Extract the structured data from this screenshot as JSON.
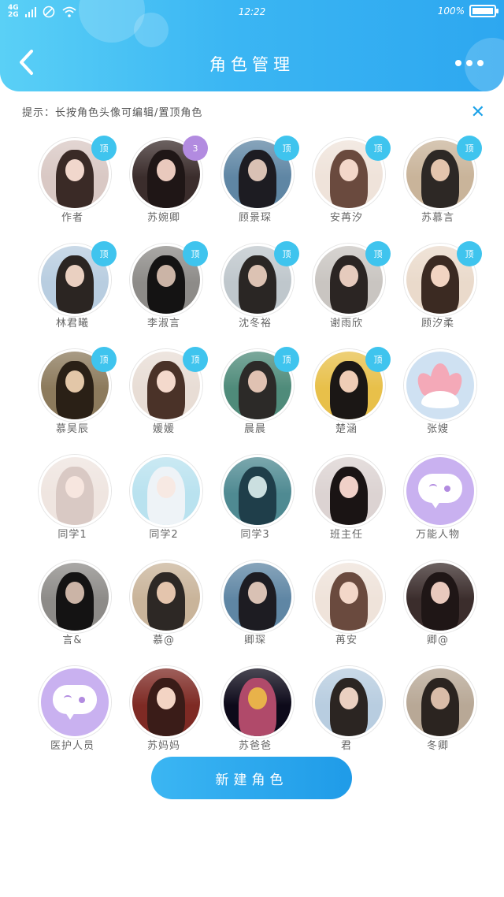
{
  "status": {
    "network_top": "4G",
    "network_bottom": "2G",
    "time": "12:22",
    "battery": "100%"
  },
  "header": {
    "title": "角色管理"
  },
  "hint": "提示：长按角色头像可编辑/置顶角色",
  "colors": {
    "accent": "#2da7f0",
    "badge_blue": "#3fc4ee",
    "badge_purple": "#b28be0"
  },
  "characters": [
    {
      "name": "作者",
      "badge": "顶",
      "badge_color": "blue",
      "img": "girl-flowers"
    },
    {
      "name": "苏婉卿",
      "badge": "3",
      "badge_color": "purple",
      "img": "girl-dark"
    },
    {
      "name": "顾景琛",
      "badge": "顶",
      "badge_color": "blue",
      "img": "boy-blue"
    },
    {
      "name": "安苒汐",
      "badge": "顶",
      "badge_color": "blue",
      "img": "girl-light"
    },
    {
      "name": "苏慕言",
      "badge": "顶",
      "badge_color": "blue",
      "img": "couple-paint"
    },
    {
      "name": "林君曦",
      "badge": "顶",
      "badge_color": "blue",
      "img": "girl-sea"
    },
    {
      "name": "李淑言",
      "badge": "顶",
      "badge_color": "blue",
      "img": "boy-dark"
    },
    {
      "name": "沈冬裕",
      "badge": "顶",
      "badge_color": "blue",
      "img": "boy-messy"
    },
    {
      "name": "谢雨欣",
      "badge": "顶",
      "badge_color": "blue",
      "img": "girl-curly"
    },
    {
      "name": "顾汐柔",
      "badge": "顶",
      "badge_color": "blue",
      "img": "girl-warm"
    },
    {
      "name": "慕昊辰",
      "badge": "顶",
      "badge_color": "blue",
      "img": "anime-boy"
    },
    {
      "name": "媛媛",
      "badge": "顶",
      "badge_color": "blue",
      "img": "girl-soft"
    },
    {
      "name": "晨晨",
      "badge": "顶",
      "badge_color": "blue",
      "img": "girl-map"
    },
    {
      "name": "楚涵",
      "badge": "顶",
      "badge_color": "blue",
      "img": "girl-yellow"
    },
    {
      "name": "张嫂",
      "badge": "",
      "badge_color": "",
      "img": "lotus"
    },
    {
      "name": "同学1",
      "badge": "",
      "badge_color": "",
      "img": "anime-girl-bear"
    },
    {
      "name": "同学2",
      "badge": "",
      "badge_color": "",
      "img": "anime-girl-white"
    },
    {
      "name": "同学3",
      "badge": "",
      "badge_color": "",
      "img": "anime-teal"
    },
    {
      "name": "班主任",
      "badge": "",
      "badge_color": "",
      "img": "girl-makeup"
    },
    {
      "name": "万能人物",
      "badge": "",
      "badge_color": "",
      "img": "chat"
    },
    {
      "name": "言&",
      "badge": "",
      "badge_color": "",
      "img": "boy-dark"
    },
    {
      "name": "慕@",
      "badge": "",
      "badge_color": "",
      "img": "couple-paint"
    },
    {
      "name": "卿琛",
      "badge": "",
      "badge_color": "",
      "img": "boy-blue"
    },
    {
      "name": "苒安",
      "badge": "",
      "badge_color": "",
      "img": "girl-light"
    },
    {
      "name": "卿@",
      "badge": "",
      "badge_color": "",
      "img": "girl-dark"
    },
    {
      "name": "医护人员",
      "badge": "",
      "badge_color": "",
      "img": "chat"
    },
    {
      "name": "苏妈妈",
      "badge": "",
      "badge_color": "",
      "img": "anime-queen"
    },
    {
      "name": "苏爸爸",
      "badge": "",
      "badge_color": "",
      "img": "night-lights"
    },
    {
      "name": "君",
      "badge": "",
      "badge_color": "",
      "img": "girl-sea"
    },
    {
      "name": "冬卿",
      "badge": "",
      "badge_color": "",
      "img": "couple-hug"
    }
  ],
  "new_button": "新建角色"
}
